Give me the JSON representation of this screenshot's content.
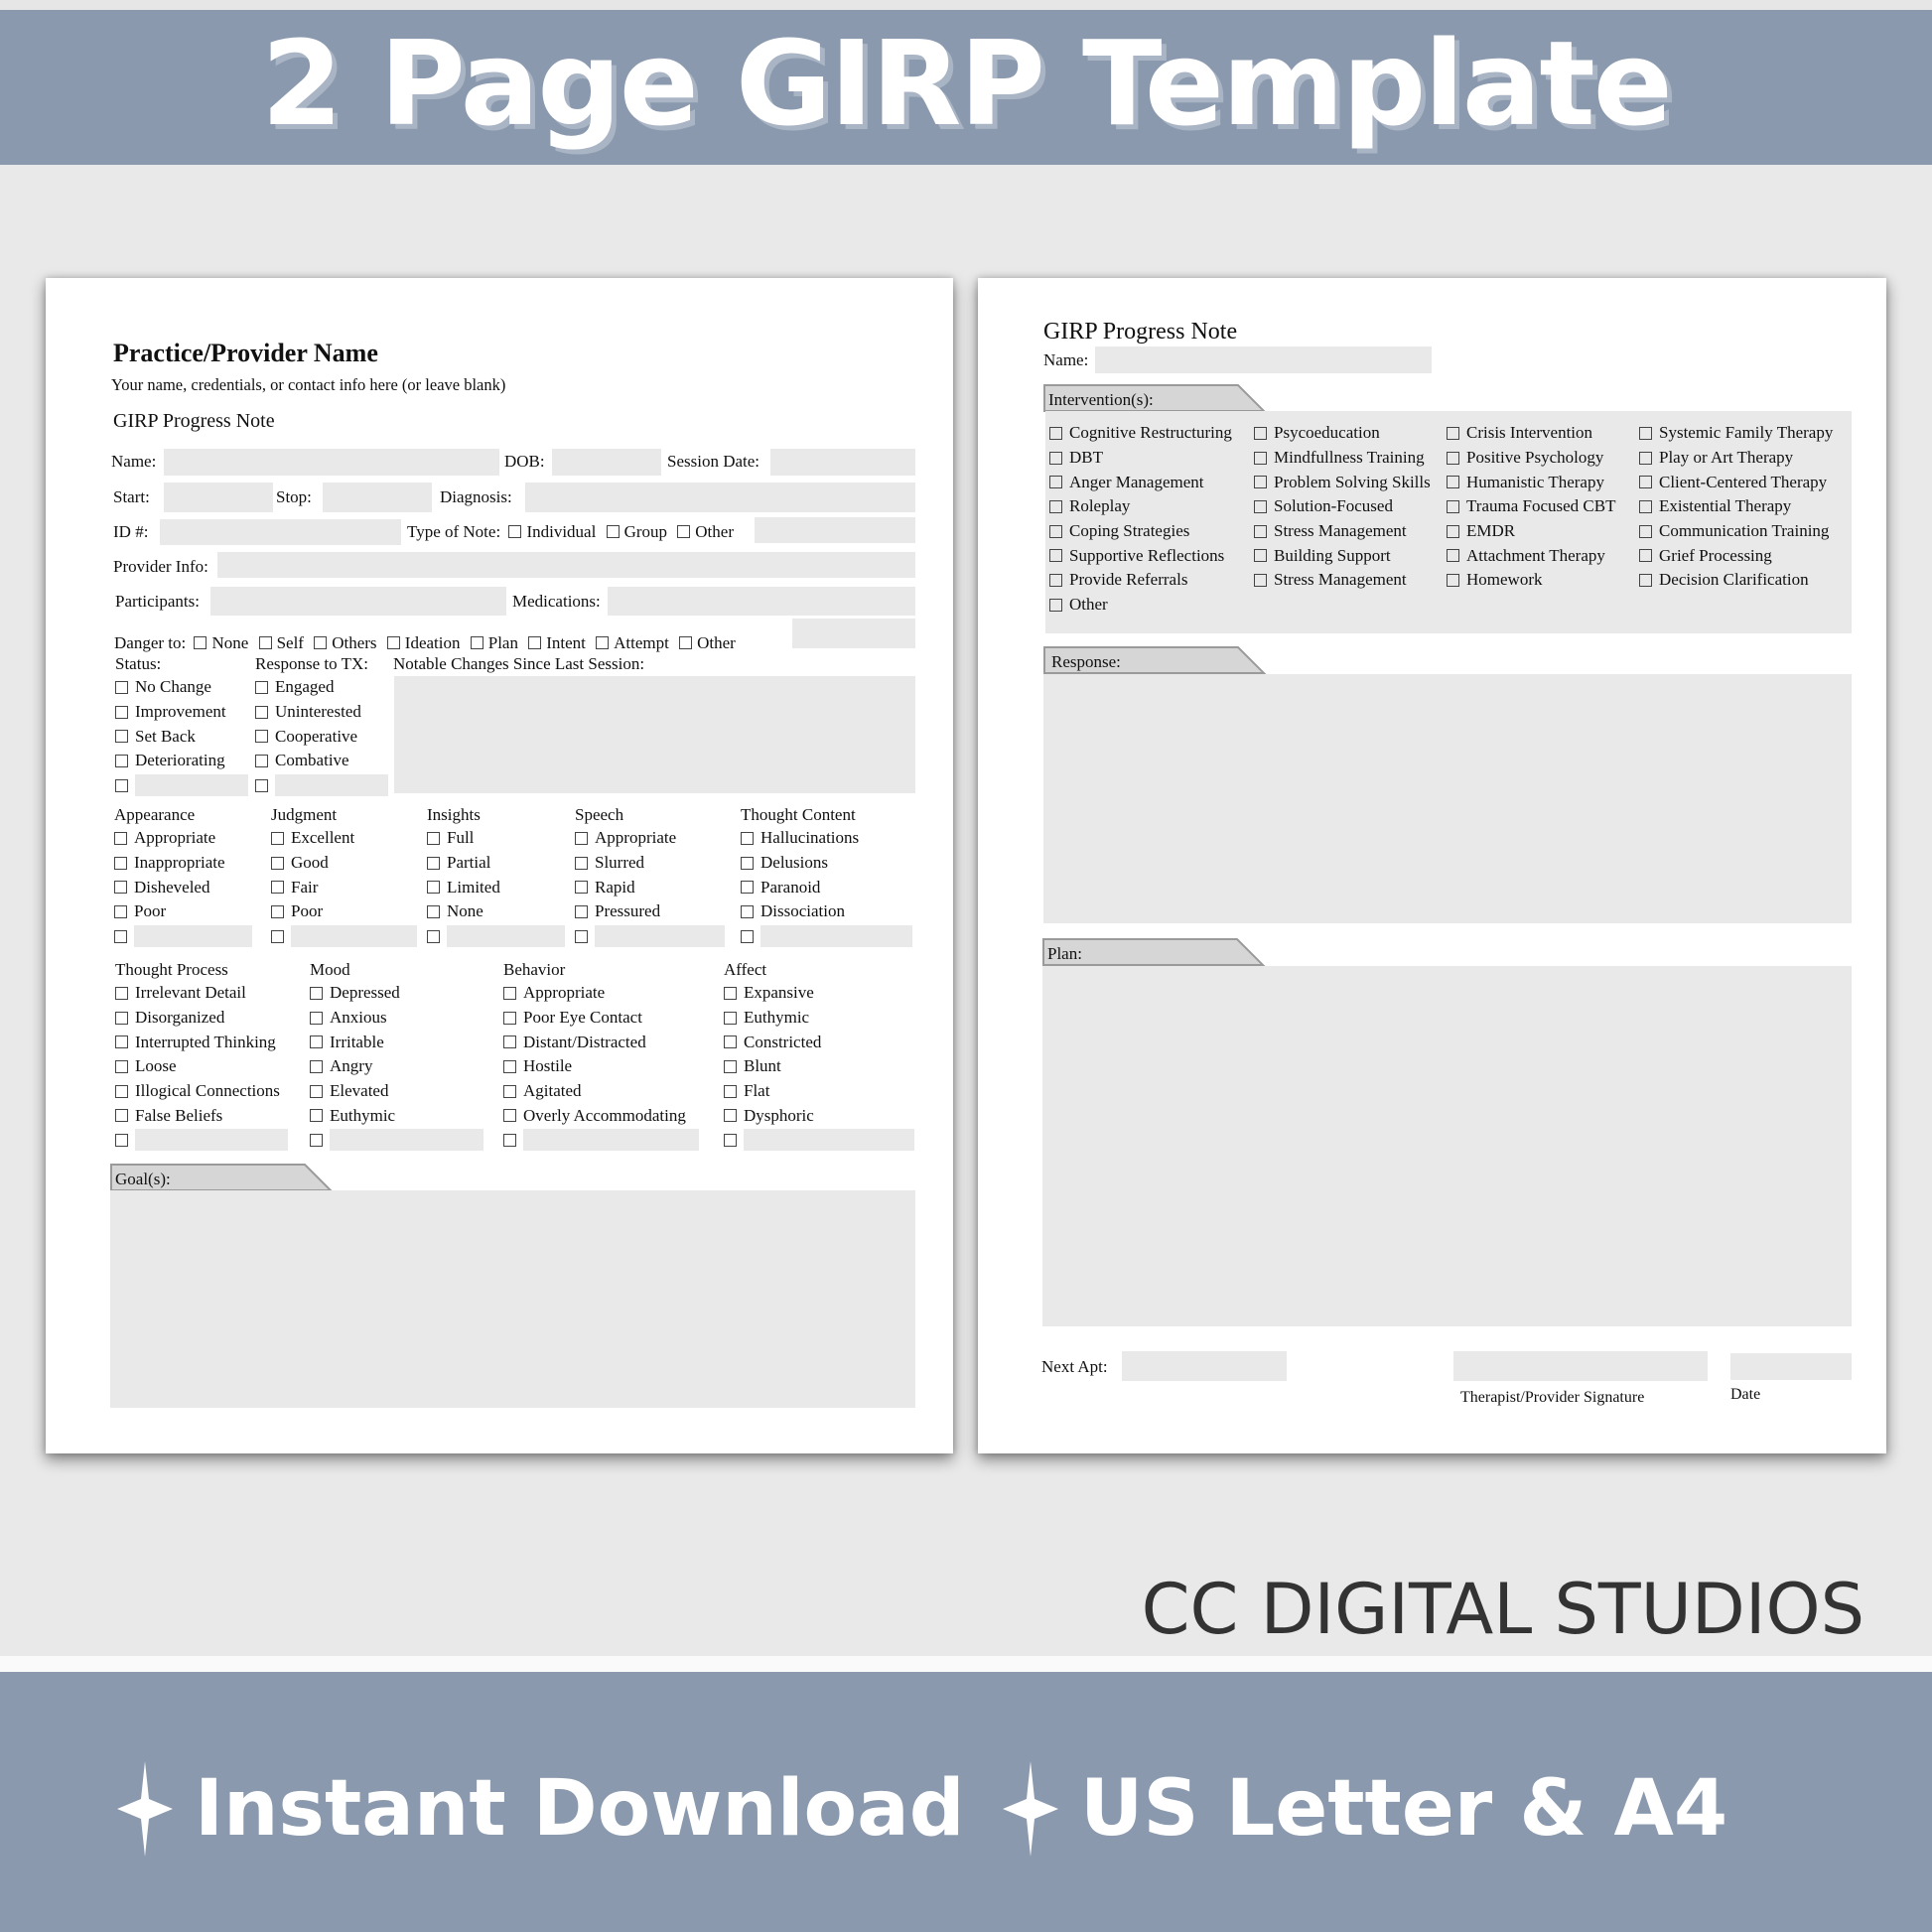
{
  "banner": {
    "title": "2 Page GIRP Template"
  },
  "page1": {
    "provider_name": "Practice/Provider Name",
    "provider_sub": "Your name, credentials, or contact info here (or leave blank)",
    "note_title": "GIRP Progress Note",
    "fields": {
      "name": "Name:",
      "dob": "DOB:",
      "session_date": "Session Date:",
      "start": "Start:",
      "stop": "Stop:",
      "diagnosis": "Diagnosis:",
      "id": "ID #:",
      "type_of_note": "Type of Note:",
      "provider_info": "Provider Info:",
      "participants": "Participants:",
      "medications": "Medications:",
      "danger_to": "Danger to:"
    },
    "type_of_note_options": [
      "Individual",
      "Group",
      "Other"
    ],
    "danger_options": [
      "None",
      "Self",
      "Others",
      "Ideation",
      "Plan",
      "Intent",
      "Attempt",
      "Other"
    ],
    "status": {
      "label": "Status:",
      "items": [
        "No Change",
        "Improvement",
        "Set Back",
        "Deteriorating"
      ]
    },
    "response_tx": {
      "label": "Response to TX:",
      "items": [
        "Engaged",
        "Uninterested",
        "Cooperative",
        "Combative"
      ]
    },
    "notable_changes_label": "Notable Changes Since Last Session:",
    "mse_row1": [
      {
        "label": "Appearance",
        "items": [
          "Appropriate",
          "Inappropriate",
          "Disheveled",
          "Poor"
        ]
      },
      {
        "label": "Judgment",
        "items": [
          "Excellent",
          "Good",
          "Fair",
          "Poor"
        ]
      },
      {
        "label": "Insights",
        "items": [
          "Full",
          "Partial",
          "Limited",
          "None"
        ]
      },
      {
        "label": "Speech",
        "items": [
          "Appropriate",
          "Slurred",
          "Rapid",
          "Pressured"
        ]
      },
      {
        "label": "Thought Content",
        "items": [
          "Hallucinations",
          "Delusions",
          "Paranoid",
          "Dissociation"
        ]
      }
    ],
    "mse_row2": [
      {
        "label": "Thought Process",
        "items": [
          "Irrelevant Detail",
          "Disorganized",
          "Interrupted Thinking",
          "Loose",
          "Illogical Connections",
          "False Beliefs"
        ]
      },
      {
        "label": "Mood",
        "items": [
          "Depressed",
          "Anxious",
          "Irritable",
          "Angry",
          "Elevated",
          "Euthymic"
        ]
      },
      {
        "label": "Behavior",
        "items": [
          "Appropriate",
          "Poor Eye Contact",
          "Distant/Distracted",
          "Hostile",
          "Agitated",
          "Overly Accommodating"
        ]
      },
      {
        "label": "Affect",
        "items": [
          "Expansive",
          "Euthymic",
          "Constricted",
          "Blunt",
          "Flat",
          "Dysphoric"
        ]
      }
    ],
    "goals_label": "Goal(s):"
  },
  "page2": {
    "note_title": "GIRP Progress Note",
    "name_label": "Name:",
    "interventions_label": "Intervention(s):",
    "interventions": [
      [
        "Cognitive Restructuring",
        "DBT",
        "Anger Management",
        "Roleplay",
        "Coping Strategies",
        "Supportive Reflections",
        "Provide Referrals",
        "Other"
      ],
      [
        "Psycoeducation",
        "Mindfullness Training",
        "Problem Solving Skills",
        "Solution-Focused",
        "Stress Management",
        "Building Support",
        "Stress Management"
      ],
      [
        "Crisis Intervention",
        "Positive Psychology",
        "Humanistic Therapy",
        "Trauma Focused CBT",
        "EMDR",
        "Attachment Therapy",
        "Homework"
      ],
      [
        "Systemic Family Therapy",
        "Play or Art Therapy",
        "Client-Centered Therapy",
        "Existential Therapy",
        "Communication Training",
        "Grief Processing",
        "Decision Clarification"
      ]
    ],
    "response_label": "Response:",
    "plan_label": "Plan:",
    "next_apt_label": "Next Apt:",
    "signature_label": "Therapist/Provider Signature",
    "date_label": "Date"
  },
  "brand": "CC DIGITAL STUDIOS",
  "features": [
    {
      "icon": "sparkle-icon",
      "label": "Instant Download"
    },
    {
      "icon": "sparkle-icon",
      "label": "US Letter & A4"
    }
  ],
  "colors": {
    "banner": "#8a99ae",
    "background": "#e9e9e9",
    "field": "#e9e9e9",
    "tab": "#d6d6d6"
  }
}
